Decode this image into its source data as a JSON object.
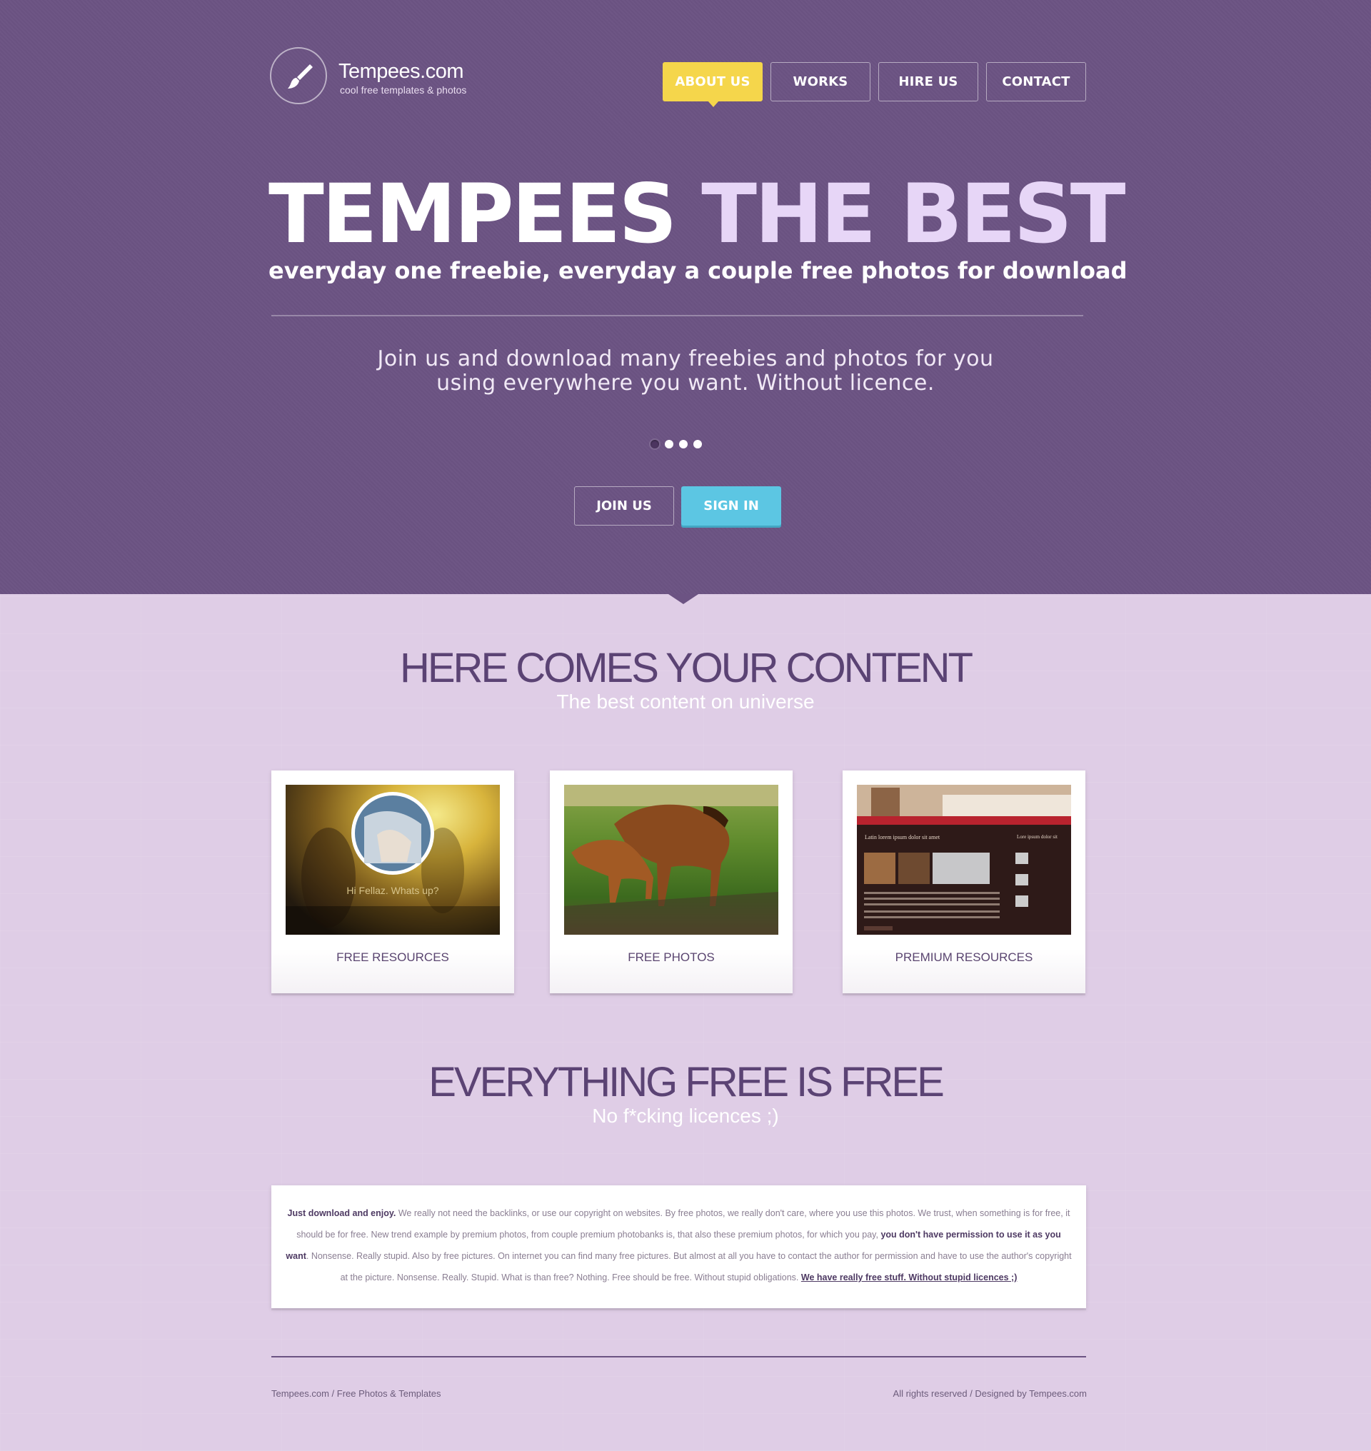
{
  "brand": {
    "name": "Tempees.com",
    "tagline": "cool free templates & photos"
  },
  "nav": {
    "items": [
      {
        "label": "ABOUT US",
        "active": true
      },
      {
        "label": "WORKS",
        "active": false
      },
      {
        "label": "HIRE US",
        "active": false
      },
      {
        "label": "CONTACT",
        "active": false
      }
    ]
  },
  "hero": {
    "headline_main": "TEMPEES",
    "headline_accent": "THE BEST",
    "subhead": "everyday one freebie, everyday a couple free photos for download",
    "intro_line1": "Join us and download many freebies and photos for you",
    "intro_line2": "using everywhere you want. Without licence.",
    "slides": 4,
    "active_slide": 1,
    "join_label": "JOIN US",
    "signin_label": "SIGN IN"
  },
  "section1": {
    "title": "HERE COMES YOUR CONTENT",
    "subtitle": "The best content on universe"
  },
  "cards": [
    {
      "label": "FREE RESOURCES",
      "image_text": "Hi Fellaz. Whats up?"
    },
    {
      "label": "FREE PHOTOS"
    },
    {
      "label": "PREMIUM RESOURCES",
      "image_heading": "Latin lorem ipsum dolor sit amet",
      "image_side": "Lore ipsum dolor sit"
    }
  ],
  "section2": {
    "title": "EVERYTHING FREE IS FREE",
    "subtitle": "No f*cking licences ;)"
  },
  "freetext": {
    "lead": "Just download and enjoy.",
    "part1": " We really not need the backlinks, or use our copyright on websites. By free photos, we really don't care, where you use this photos. We trust, when something is for free, it should be for free. New trend example by premium photos, from couple premium photobanks is, that also these premium photos, for which you pay, ",
    "bold": "you don't have permission to use it as you want",
    "part2": ". Nonsense. Really stupid. Also by free pictures. On internet you can find many free pictures. But almost at all you have to contact the author for permission and have to use the author's copyright at the picture. Nonsense. Really. Stupid. What is than free? Nothing. Free should be free. Without stupid obligations. ",
    "link": "We have really free stuff. Without stupid licences ;)"
  },
  "footer": {
    "left": "Tempees.com / Free Photos & Templates",
    "right": "All rights reserved / Designed by Tempees.com"
  },
  "colors": {
    "hero_bg": "#6c5383",
    "content_bg": "#dfcde6",
    "accent_yellow": "#f5d64b",
    "accent_blue": "#5cc6e3",
    "headline_accent": "#e7d6f7"
  }
}
